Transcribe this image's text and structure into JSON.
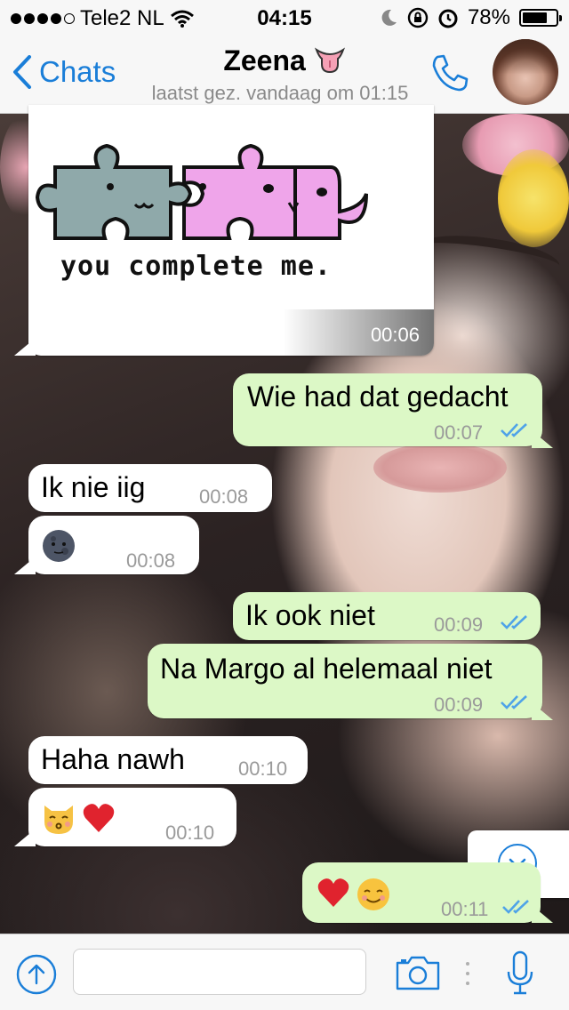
{
  "status_bar": {
    "carrier": "Tele2 NL",
    "time": "04:15",
    "battery": "78%",
    "battery_level": 0.78
  },
  "nav": {
    "back_label": "Chats",
    "contact_name": "Zeena",
    "contact_emoji": "tongue-emoji",
    "last_seen": "laatst gez. vandaag om 01:15"
  },
  "messages": [
    {
      "direction": "in",
      "type": "image",
      "image_caption": "you complete me.",
      "time": "00:06"
    },
    {
      "direction": "out",
      "text": "Wie had dat gedacht",
      "time": "00:07",
      "read": true
    },
    {
      "direction": "in",
      "text": "Ik nie iig",
      "time": "00:08"
    },
    {
      "direction": "in",
      "emoji": "new-moon-face-emoji",
      "time": "00:08"
    },
    {
      "direction": "out",
      "text": "Ik ook niet",
      "time": "00:09",
      "read": true
    },
    {
      "direction": "out",
      "text": "Na Margo al helemaal niet",
      "time": "00:09",
      "read": true
    },
    {
      "direction": "in",
      "text": "Haha nawh",
      "time": "00:10"
    },
    {
      "direction": "in",
      "emoji": "kissing-cat-and-heart-emoji",
      "time": "00:10"
    },
    {
      "direction": "out",
      "emoji": "heart-and-smiling-face-emoji",
      "time": "00:11",
      "read": true
    }
  ],
  "input_bar": {
    "placeholder": ""
  },
  "colors": {
    "accent": "#1a7ed8",
    "outgoing_bubble": "#dcf8c6",
    "incoming_bubble": "#ffffff",
    "read_checks": "#4fa3e8"
  }
}
